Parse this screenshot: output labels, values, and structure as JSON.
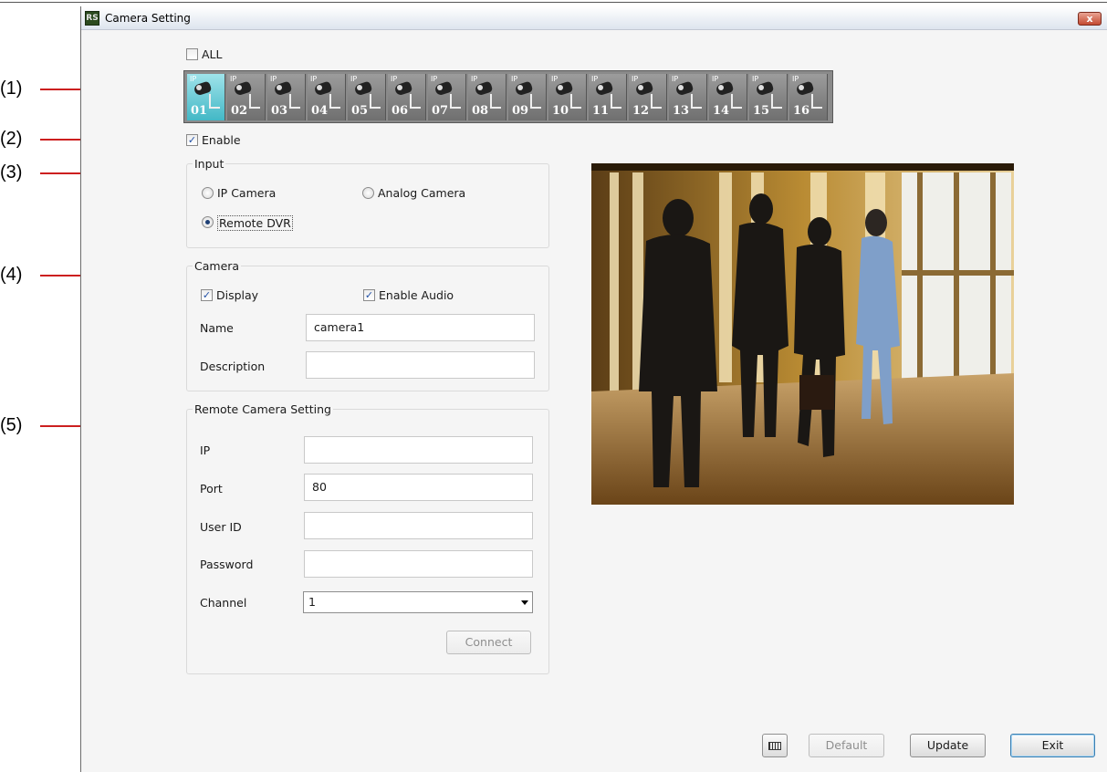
{
  "annotations": [
    "(1)",
    "(2)",
    "(3)",
    "(4)",
    "(5)"
  ],
  "window": {
    "title": "Camera Setting",
    "app_icon_text": "RS",
    "close_glyph": "x"
  },
  "all_checkbox": {
    "label": "ALL",
    "checked": false
  },
  "cameras": {
    "ip_tag": "IP",
    "selected": "01",
    "items": [
      "01",
      "02",
      "03",
      "04",
      "05",
      "06",
      "07",
      "08",
      "09",
      "10",
      "11",
      "12",
      "13",
      "14",
      "15",
      "16"
    ]
  },
  "enable": {
    "label": "Enable",
    "checked": true
  },
  "input_group": {
    "title": "Input",
    "options": {
      "ip_camera": "IP Camera",
      "analog_camera": "Analog Camera",
      "remote_dvr": "Remote DVR"
    },
    "selected": "remote_dvr"
  },
  "camera_group": {
    "title": "Camera",
    "display_label": "Display",
    "display_checked": true,
    "audio_label": "Enable Audio",
    "audio_checked": true,
    "name_label": "Name",
    "name_value": "camera1",
    "description_label": "Description",
    "description_value": ""
  },
  "remote_group": {
    "title": "Remote Camera Setting",
    "ip_label": "IP",
    "ip_value": "",
    "port_label": "Port",
    "port_value": "80",
    "userid_label": "User ID",
    "userid_value": "",
    "password_label": "Password",
    "password_value": "",
    "channel_label": "Channel",
    "channel_value": "1",
    "connect_label": "Connect"
  },
  "footer": {
    "default_label": "Default",
    "update_label": "Update",
    "exit_label": "Exit"
  },
  "colors": {
    "annotation_line": "#cc1f1f",
    "selected_tile": "#43b8c6",
    "window_bg": "#f5f5f5"
  }
}
